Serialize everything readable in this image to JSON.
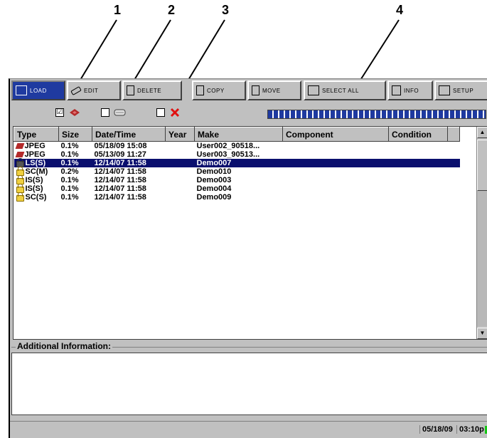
{
  "callouts": [
    "1",
    "2",
    "3",
    "4"
  ],
  "toolbar": {
    "buttons": [
      {
        "label": "LOAD",
        "icon": "folder-icon"
      },
      {
        "label": "EDIT",
        "icon": "pencil-icon"
      },
      {
        "label": "DELETE",
        "icon": "document-icon"
      },
      {
        "label": "COPY",
        "icon": "document-icon"
      },
      {
        "label": "MOVE",
        "icon": "document-icon"
      },
      {
        "label": "SELECT ALL",
        "icon": "select-all-icon"
      },
      {
        "label": "INFO",
        "icon": "floppy-icon"
      },
      {
        "label": "SETUP",
        "icon": "toolbox-icon"
      }
    ]
  },
  "filters": {
    "image_checked": "☑",
    "image_icon": "jpeg-image-icon",
    "report_icon": "report-icon",
    "delete_icon": "red-x-icon",
    "progress": 1.0
  },
  "table": {
    "columns": [
      "Type",
      "Size",
      "Date/Time",
      "Year",
      "Make",
      "Component",
      "Condition"
    ],
    "rows": [
      {
        "type": "JPEG",
        "size": "0.1%",
        "datetime": "05/18/09 15:08",
        "year": "",
        "make": "User002_90518...",
        "component": "",
        "condition": "",
        "icon": "jpeg",
        "selected": false
      },
      {
        "type": "JPEG",
        "size": "0.1%",
        "datetime": "05/13/09 11:27",
        "year": "",
        "make": "User003_90513...",
        "component": "",
        "condition": "",
        "icon": "jpeg",
        "selected": false
      },
      {
        "type": "LS(S)",
        "size": "0.1%",
        "datetime": "12/14/07 11:58",
        "year": "",
        "make": "Demo007",
        "component": "",
        "condition": "",
        "icon": "lock-dark",
        "selected": true
      },
      {
        "type": "SC(M)",
        "size": "0.2%",
        "datetime": "12/14/07 11:58",
        "year": "",
        "make": "Demo010",
        "component": "",
        "condition": "",
        "icon": "lock",
        "selected": false
      },
      {
        "type": "IS(S)",
        "size": "0.1%",
        "datetime": "12/14/07 11:58",
        "year": "",
        "make": "Demo003",
        "component": "",
        "condition": "",
        "icon": "lock",
        "selected": false
      },
      {
        "type": "IS(S)",
        "size": "0.1%",
        "datetime": "12/14/07 11:58",
        "year": "",
        "make": "Demo004",
        "component": "",
        "condition": "",
        "icon": "lock",
        "selected": false
      },
      {
        "type": "SC(S)",
        "size": "0.1%",
        "datetime": "12/14/07 11:58",
        "year": "",
        "make": "Demo009",
        "component": "",
        "condition": "",
        "icon": "lock",
        "selected": false
      }
    ]
  },
  "additional_info": {
    "label": "Additional Information:"
  },
  "status": {
    "date": "05/18/09",
    "time": "03:10p"
  },
  "colors": {
    "selection": "#0a0f6e",
    "progress": "#1f3aa0",
    "active_button": "#1f3aa0"
  }
}
